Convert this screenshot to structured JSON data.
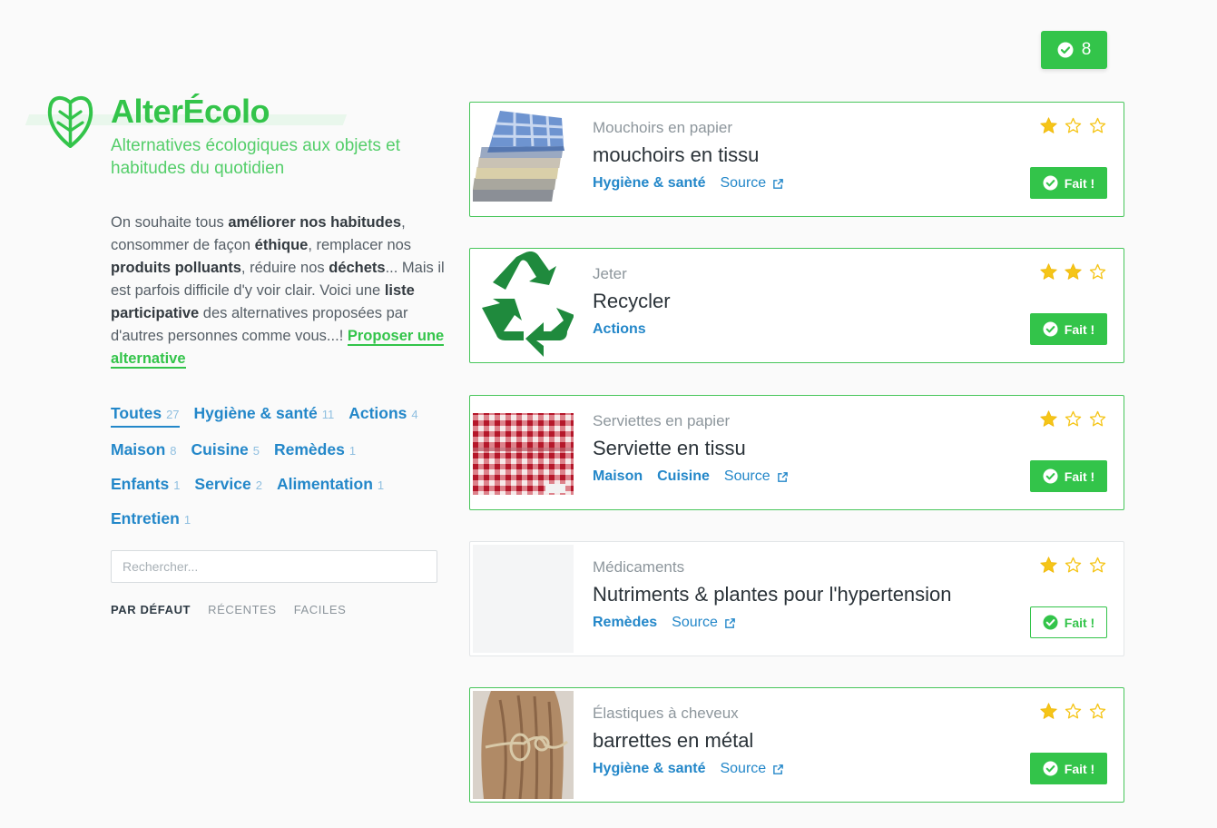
{
  "header": {
    "done_count": "8"
  },
  "brand": {
    "title": "AlterÉcolo",
    "tagline": "Alternatives écologiques aux objets et habitudes du quotidien",
    "color": "#33c44a"
  },
  "intro": {
    "t1": "On souhaite tous ",
    "b1": "améliorer nos habitudes",
    "t2": ", consommer de façon ",
    "b2": "éthique",
    "t3": ", remplacer nos ",
    "b3": "produits polluants",
    "t4": ", réduire nos ",
    "b4": "déchets",
    "t5": "... Mais il est parfois difficile d'y voir clair. Voici une ",
    "b5": "liste participative",
    "t6": " des alternatives proposées par d'autres personnes comme vous...! ",
    "link": "Proposer une alternative"
  },
  "filters": [
    {
      "label": "Toutes",
      "count": "27",
      "active": true
    },
    {
      "label": "Hygiène & santé",
      "count": "11"
    },
    {
      "label": "Actions",
      "count": "4"
    },
    {
      "label": "Maison",
      "count": "8"
    },
    {
      "label": "Cuisine",
      "count": "5"
    },
    {
      "label": "Remèdes",
      "count": "1"
    },
    {
      "label": "Enfants",
      "count": "1"
    },
    {
      "label": "Service",
      "count": "2"
    },
    {
      "label": "Alimentation",
      "count": "1"
    },
    {
      "label": "Entretien",
      "count": "1"
    }
  ],
  "search": {
    "placeholder": "Rechercher..."
  },
  "sort": {
    "default": "PAR DÉFAUT",
    "recent": "RÉCENTES",
    "easy": "FACILES"
  },
  "cards": [
    {
      "category": "Mouchoirs en papier",
      "title": "mouchoirs en tissu",
      "tags": [
        "Hygiène & santé"
      ],
      "source": "Source",
      "rating": 1,
      "done_label": "Fait !",
      "done": false,
      "image": "handkerchiefs"
    },
    {
      "category": "Jeter",
      "title": "Recycler",
      "tags": [
        "Actions"
      ],
      "source": "",
      "rating": 2,
      "done_label": "Fait !",
      "done": false,
      "image": "recycle-symbol"
    },
    {
      "category": "Serviettes en papier",
      "title": "Serviette en tissu",
      "tags": [
        "Maison",
        "Cuisine"
      ],
      "source": "Source",
      "rating": 1,
      "done_label": "Fait !",
      "done": false,
      "image": "checkered-napkin"
    },
    {
      "category": "Médicaments",
      "title": "Nutriments & plantes pour l'hypertension",
      "tags": [
        "Remèdes"
      ],
      "source": "Source",
      "rating": 1,
      "done_label": "Fait !",
      "done": true,
      "image": "none"
    },
    {
      "category": "Élastiques à cheveux",
      "title": "barrettes en métal",
      "tags": [
        "Hygiène & santé"
      ],
      "source": "Source",
      "rating": 1,
      "done_label": "Fait !",
      "done": false,
      "image": "hair-barrette"
    }
  ],
  "colors": {
    "accent": "#33c44a",
    "link": "#2387c9",
    "star": "#f5c518",
    "recycle": "#1f8a3d"
  }
}
